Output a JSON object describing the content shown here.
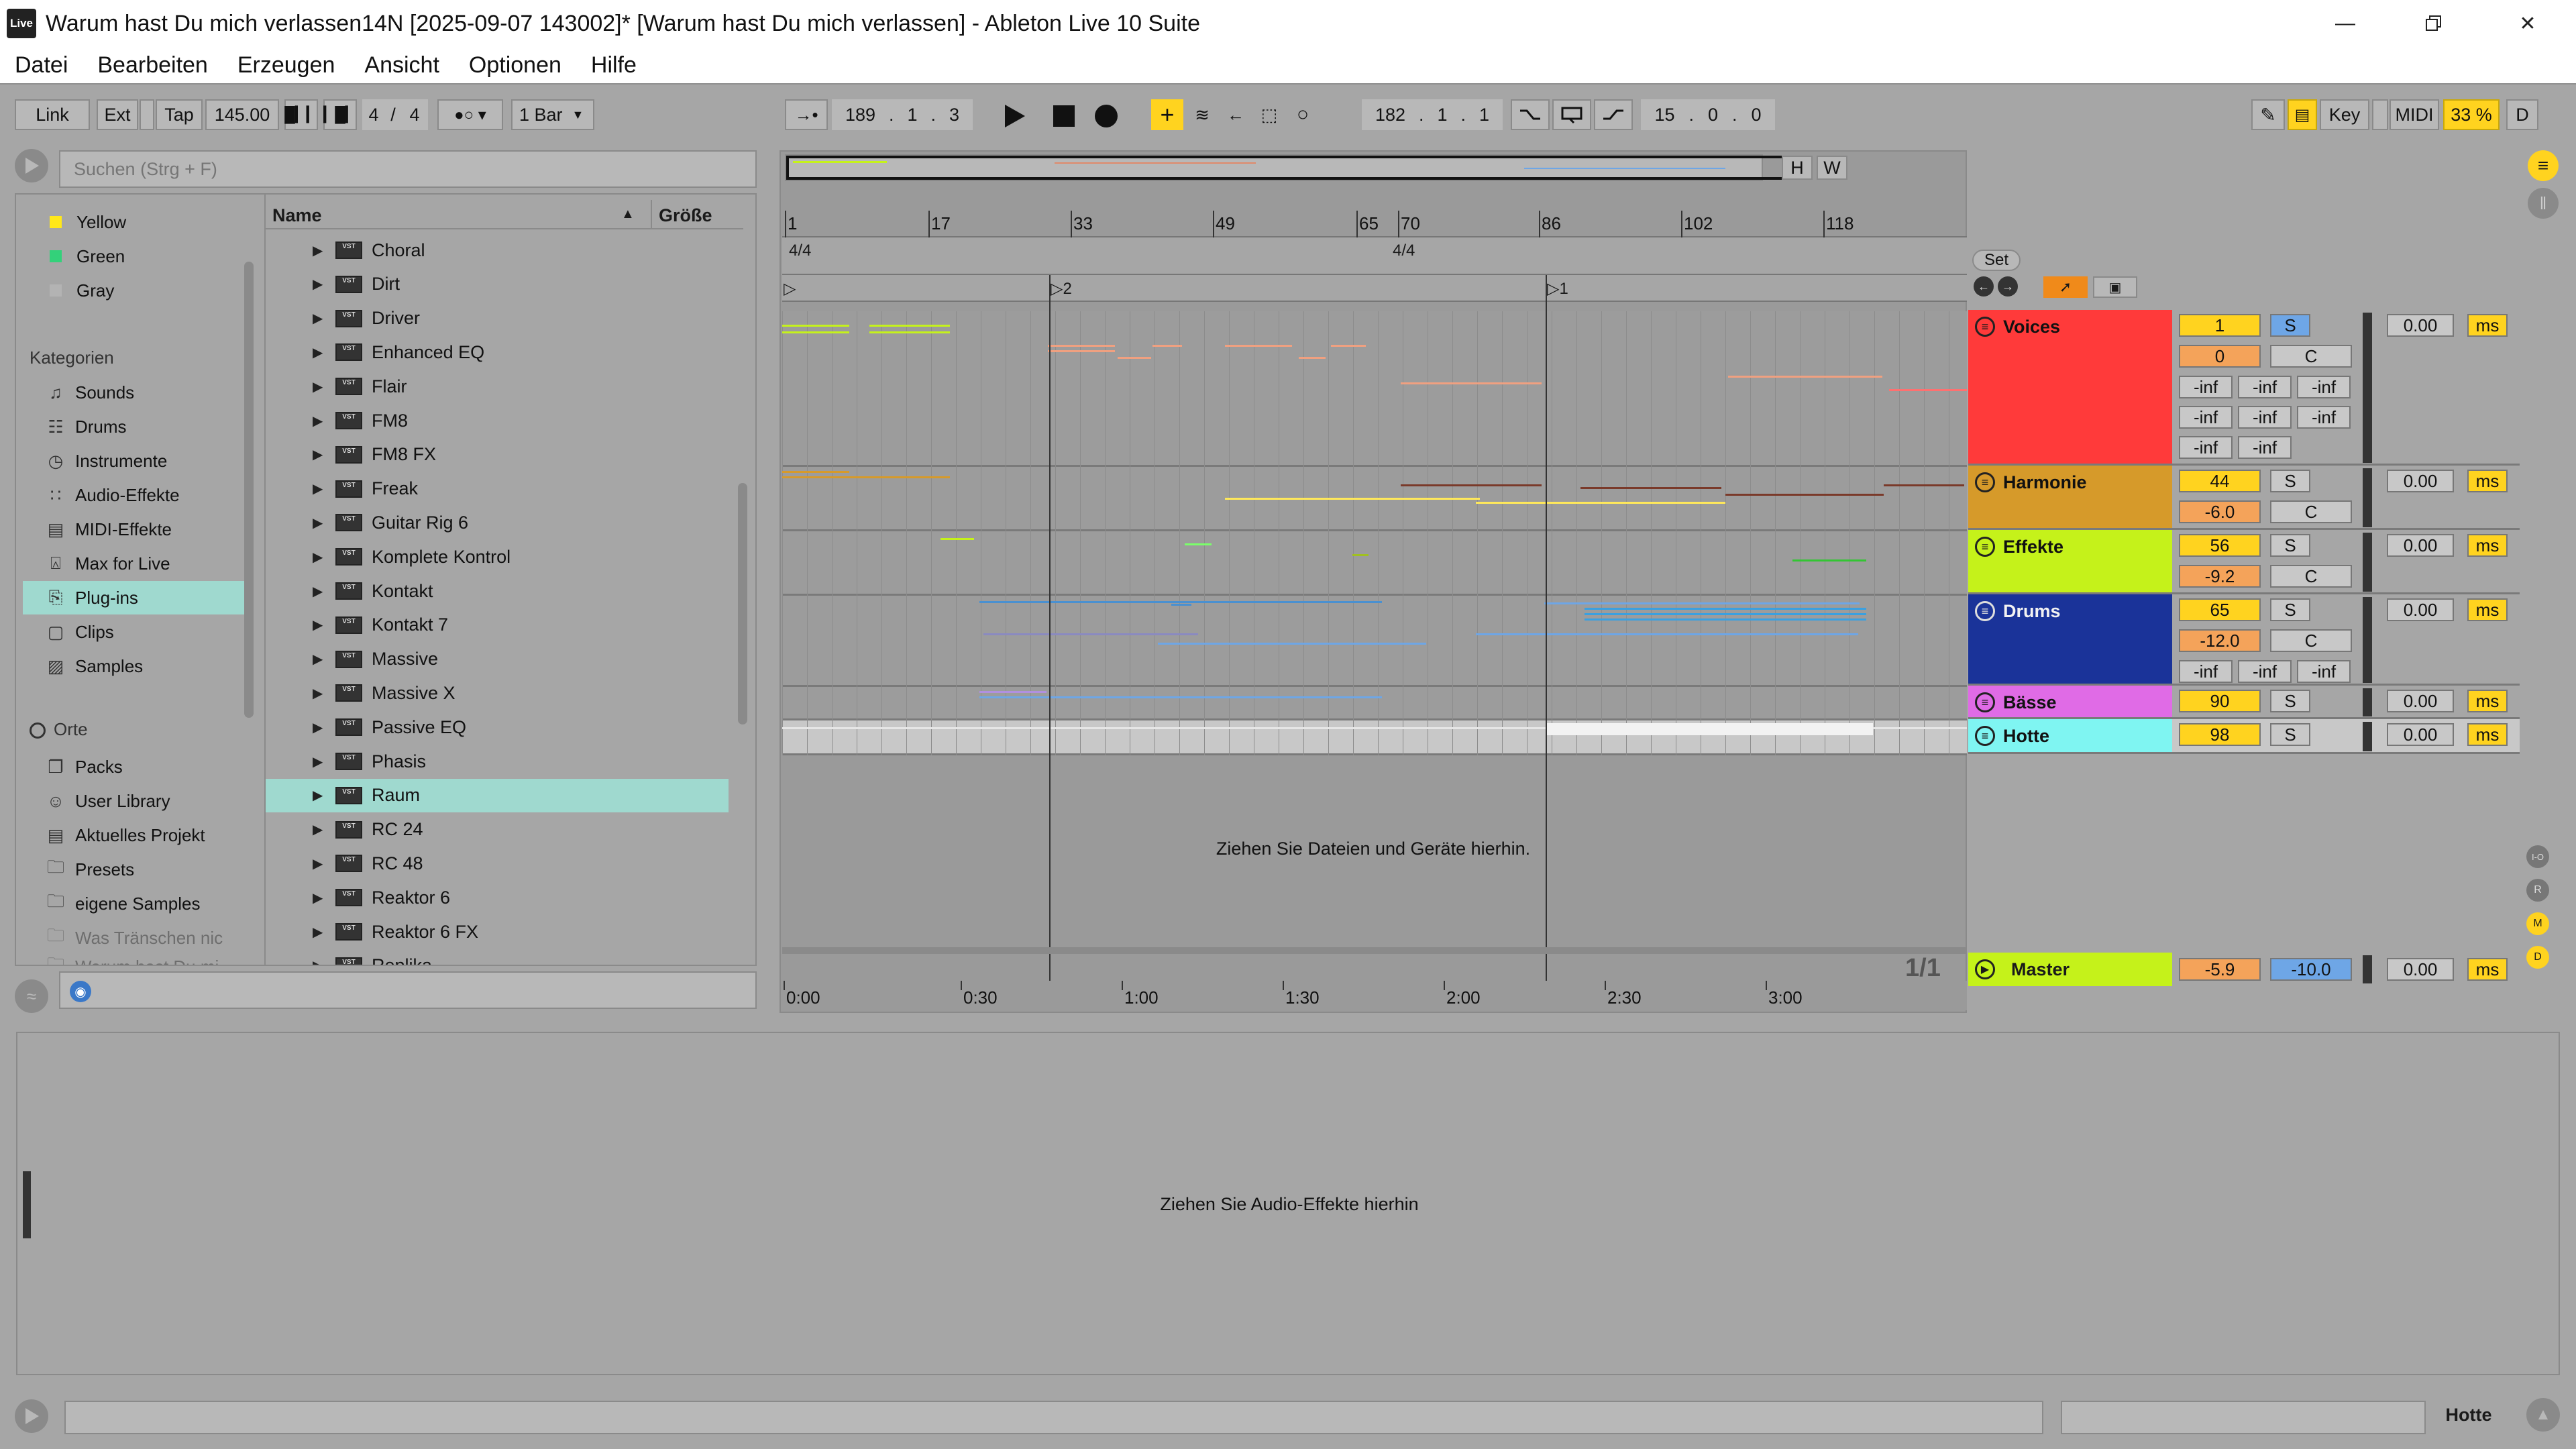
{
  "window": {
    "app_icon": "Live",
    "title": "Warum hast Du mich verlassen14N [2025-09-07 143002]*  [Warum hast Du mich verlassen] - Ableton Live 10 Suite",
    "controls": [
      "minimize-icon",
      "restore-icon",
      "close-icon"
    ]
  },
  "menu": [
    "Datei",
    "Bearbeiten",
    "Erzeugen",
    "Ansicht",
    "Optionen",
    "Hilfe"
  ],
  "control_bar": {
    "link": "Link",
    "ext": "Ext",
    "tap": "Tap",
    "tempo": "145.00",
    "signature_num": "4",
    "signature_sep": "/",
    "signature_den": "4",
    "quantize": "1 Bar",
    "arrangement_position": [
      "189",
      "1",
      "3"
    ],
    "loop_start": [
      "182",
      "1",
      "1"
    ],
    "loop_length": [
      "15",
      "0",
      "0"
    ],
    "key": "Key",
    "midi": "MIDI",
    "cpu": "33 %",
    "d": "D"
  },
  "browser": {
    "search_placeholder": "Suchen (Strg + F)",
    "colors": [
      {
        "label": "Yellow",
        "color": "#ffe81a"
      },
      {
        "label": "Green",
        "color": "#33d17a"
      },
      {
        "label": "Gray",
        "color": "#b3b3b3"
      }
    ],
    "categories_header": "Kategorien",
    "categories": [
      {
        "label": "Sounds",
        "icon": "sounds-icon"
      },
      {
        "label": "Drums",
        "icon": "drums-icon"
      },
      {
        "label": "Instrumente",
        "icon": "instrument-icon"
      },
      {
        "label": "Audio-Effekte",
        "icon": "audio-effects-icon"
      },
      {
        "label": "MIDI-Effekte",
        "icon": "midi-effects-icon"
      },
      {
        "label": "Max for Live",
        "icon": "max-icon"
      },
      {
        "label": "Plug-ins",
        "icon": "plugin-icon",
        "selected": true
      },
      {
        "label": "Clips",
        "icon": "clips-icon"
      },
      {
        "label": "Samples",
        "icon": "samples-icon"
      }
    ],
    "places_header": "Orte",
    "places": [
      {
        "label": "Packs",
        "icon": "packs-icon"
      },
      {
        "label": "User Library",
        "icon": "user-icon"
      },
      {
        "label": "Aktuelles Projekt",
        "icon": "project-icon"
      },
      {
        "label": "Presets",
        "icon": "folder-icon"
      },
      {
        "label": "eigene Samples",
        "icon": "folder-icon"
      },
      {
        "label": "Was Tränschen nic",
        "icon": "folder-icon",
        "dim": true
      },
      {
        "label": "Warum hast Du mi",
        "icon": "folder-icon",
        "dim": true
      }
    ],
    "columns": {
      "name": "Name",
      "size": "Größe"
    },
    "items": [
      "Choral",
      "Dirt",
      "Driver",
      "Enhanced EQ",
      "Flair",
      "FM8",
      "FM8 FX",
      "Freak",
      "Guitar Rig 6",
      "Komplete Kontrol",
      "Kontakt",
      "Kontakt 7",
      "Massive",
      "Massive X",
      "Passive EQ",
      "Phasis",
      "Raum",
      "RC 24",
      "RC 48",
      "Reaktor 6",
      "Reaktor 6 FX",
      "Replika"
    ],
    "selected_item": "Raum",
    "vst_badge": "VST"
  },
  "arrangement": {
    "bars": [
      "1",
      "17",
      "33",
      "49",
      "65",
      "70",
      "86",
      "102",
      "118"
    ],
    "signatures": [
      "4/4",
      "4/4"
    ],
    "locators": [
      "2",
      "1"
    ],
    "times": [
      "0:00",
      "0:30",
      "1:00",
      "1:30",
      "2:00",
      "2:30",
      "3:00"
    ],
    "drop_hint": "Ziehen Sie Dateien und Geräte hierhin.",
    "page": "1/1",
    "set_label": "Set",
    "overview_buttons": [
      "H",
      "W"
    ]
  },
  "tracks": [
    {
      "name": "Voices",
      "color": "#ff3a3a",
      "num": "1",
      "pan": "0",
      "sends": [
        "-inf",
        "-inf",
        "-inf",
        "-inf",
        "-inf",
        "-inf",
        "-inf",
        "-inf"
      ],
      "delay": "0.00",
      "unit": "ms",
      "solo": "S",
      "c": "C"
    },
    {
      "name": "Harmonie",
      "color": "#d69a2a",
      "num": "44",
      "pan": "-6.0",
      "delay": "0.00",
      "unit": "ms",
      "solo": "S",
      "c": "C"
    },
    {
      "name": "Effekte",
      "color": "#c5f21a",
      "num": "56",
      "pan": "-9.2",
      "delay": "0.00",
      "unit": "ms",
      "solo": "S",
      "c": "C"
    },
    {
      "name": "Drums",
      "color": "#1a3399",
      "num": "65",
      "pan": "-12.0",
      "sends": [
        "-inf",
        "-inf",
        "-inf"
      ],
      "delay": "0.00",
      "unit": "ms",
      "solo": "S",
      "c": "C"
    },
    {
      "name": "Bässe",
      "color": "#e06be6",
      "num": "90",
      "delay": "0.00",
      "unit": "ms",
      "solo": "S"
    },
    {
      "name": "Hotte",
      "color": "#7ff5f2",
      "num": "98",
      "delay": "0.00",
      "unit": "ms",
      "solo": "S"
    }
  ],
  "master": {
    "name": "Master",
    "color": "#c5f21a",
    "vol": "-5.9",
    "pan": "-10.0",
    "delay": "0.00",
    "unit": "ms"
  },
  "devices": {
    "drop_hint": "Ziehen Sie Audio-Effekte hierhin"
  },
  "status": {
    "track_name": "Hotte"
  },
  "side_buttons": [
    "I-O",
    "R",
    "M",
    "D"
  ]
}
